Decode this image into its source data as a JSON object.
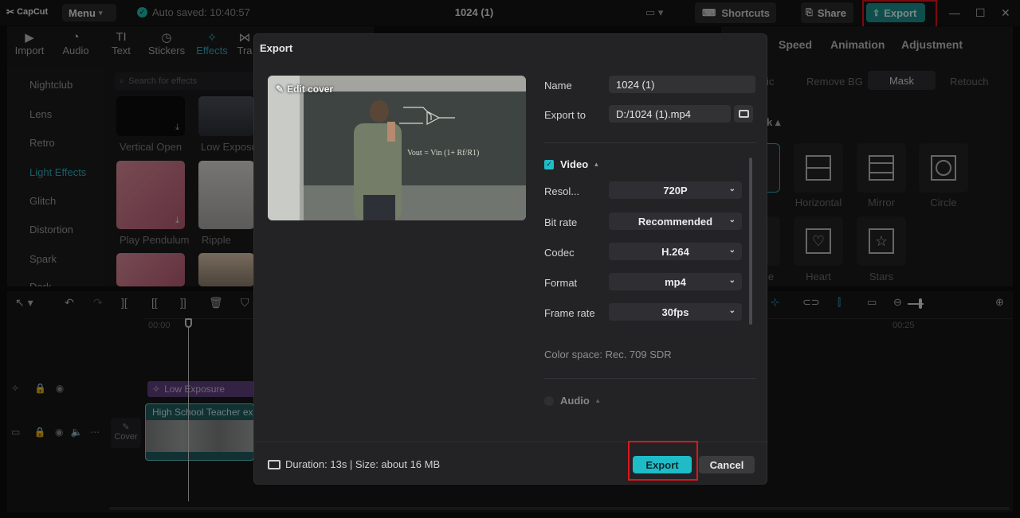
{
  "app": {
    "logo": "CapCut",
    "menu_label": "Menu",
    "autosave_text": "Auto saved: 10:40:57",
    "project_title": "1024 (1)"
  },
  "topbar": {
    "shortcuts_label": "Shortcuts",
    "share_label": "Share",
    "export_label": "Export"
  },
  "media_toolbar": [
    {
      "label": "Import",
      "icon": "import-icon"
    },
    {
      "label": "Audio",
      "icon": "audio-icon"
    },
    {
      "label": "Text",
      "icon": "text-icon"
    },
    {
      "label": "Stickers",
      "icon": "stickers-icon"
    },
    {
      "label": "Effects",
      "icon": "effects-icon"
    },
    {
      "label": "Tra",
      "icon": "transitions-icon"
    }
  ],
  "effects_sidebar": [
    "Nightclub",
    "Lens",
    "Retro",
    "Light Effects",
    "Glitch",
    "Distortion",
    "Spark",
    "Dark"
  ],
  "effects_search_placeholder": "Search for effects",
  "effects_grid": [
    "Vertical Open",
    "Low Exposu",
    "Play Pendulum",
    "Ripple"
  ],
  "right_panel": {
    "tabs": [
      "Speed",
      "Animation",
      "Adjustment"
    ],
    "subtabs": [
      "ic",
      "Remove BG",
      "Mask",
      "Retouch"
    ],
    "section_label": "k",
    "masks": [
      "Horizontal",
      "Mirror",
      "Circle",
      "le",
      "Heart",
      "Stars"
    ]
  },
  "timeline": {
    "time_start": "00:00",
    "time_end": "00:25",
    "effect_clip": "Low Exposure",
    "video_clip": "High School Teacher exp",
    "cover_label": "Cover"
  },
  "export_dialog": {
    "title": "Export",
    "edit_cover": "Edit cover",
    "name_label": "Name",
    "name_value": "1024 (1)",
    "export_to_label": "Export to",
    "export_to_value": "D:/1024 (1).mp4",
    "video_section": "Video",
    "resolution_label": "Resol...",
    "resolution_value": "720P",
    "bitrate_label": "Bit rate",
    "bitrate_value": "Recommended",
    "codec_label": "Codec",
    "codec_value": "H.264",
    "format_label": "Format",
    "format_value": "mp4",
    "framerate_label": "Frame rate",
    "framerate_value": "30fps",
    "color_space": "Color space: Rec. 709 SDR",
    "audio_section": "Audio",
    "footer_info": "Duration: 13s | Size: about 16 MB",
    "export_button": "Export",
    "cancel_button": "Cancel"
  },
  "colors": {
    "accent": "#1fbcc8",
    "highlight_box": "#e1141b",
    "effects_active": "#2fa7b8"
  }
}
